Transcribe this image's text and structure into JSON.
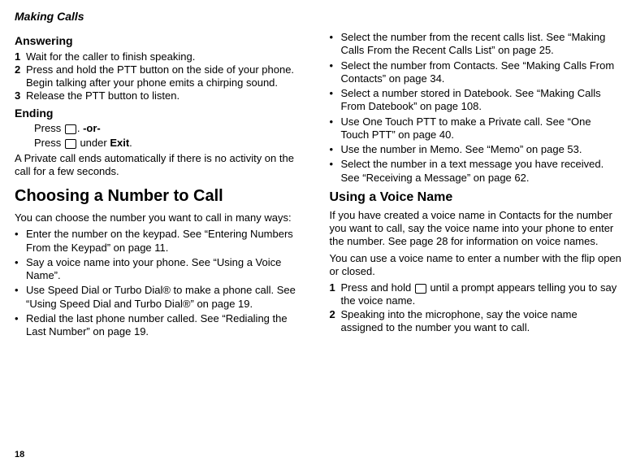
{
  "header": "Making Calls",
  "page_number": "18",
  "left": {
    "answering_title": "Answering",
    "answering_steps": [
      "Wait for the caller to finish speaking.",
      "Press and hold the PTT button on the side of your phone. Begin talking after your phone emits a chirping sound.",
      "Release the PTT button to listen."
    ],
    "ending_title": "Ending",
    "ending_line1_prefix": "Press ",
    "ending_line1_suffix": ". ",
    "ending_or": "-or-",
    "ending_line2_prefix": "Press ",
    "ending_line2_mid": " under ",
    "ending_line2_bold": "Exit",
    "ending_line2_suffix": ".",
    "ending_note": "A Private call ends automatically if there is no activity on the call for a few seconds.",
    "choosing_title": "Choosing a Number to Call",
    "choosing_intro": "You can choose the number you want to call in many ways:",
    "choosing_bullets": [
      "Enter the number on the keypad. See “Entering Numbers From the Keypad” on page 11.",
      "Say a voice name into your phone. See “Using a Voice Name”.",
      "Use Speed Dial or Turbo Dial® to make a phone call. See “Using Speed Dial and Turbo Dial®” on page 19.",
      "Redial the last phone number called. See “Redialing the Last Number” on page 19."
    ]
  },
  "right": {
    "top_bullets": [
      "Select the number from the recent calls list. See “Making Calls From the Recent Calls List” on page 25.",
      "Select the number from Contacts. See “Making Calls From Contacts” on page 34.",
      "Select a number stored in Datebook. See “Making Calls From Datebook” on page 108.",
      "Use One Touch PTT to make a Private call. See “One Touch PTT” on page 40.",
      "Use the number in Memo. See “Memo” on page 53.",
      "Select the number in a text message you have received. See “Receiving a Message” on page 62."
    ],
    "voice_title": "Using a Voice Name",
    "voice_p1": "If you have created a voice name in Contacts for the number you want to call, say the voice name into your phone to enter the number. See page 28 for information on voice names.",
    "voice_p2": "You can use a voice name to enter a number with the flip open or closed.",
    "voice_step1_prefix": "Press and hold ",
    "voice_step1_suffix": " until a prompt appears telling you to say the voice name.",
    "voice_step2": "Speaking into the microphone, say the voice name assigned to the number you want to call."
  }
}
